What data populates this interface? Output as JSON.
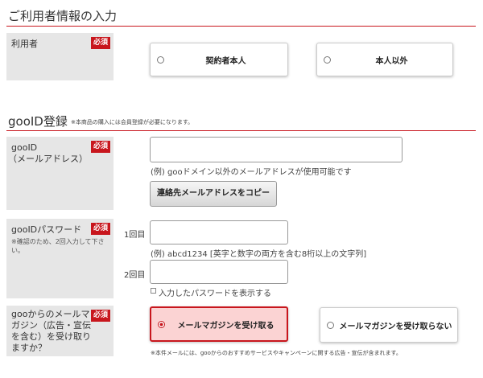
{
  "section1": {
    "title": "ご利用者情報の入力"
  },
  "user": {
    "label": "利用者",
    "required": "必須",
    "options": [
      "契約者本人",
      "本人以外"
    ]
  },
  "section2": {
    "title": "gooID登録",
    "note": "※本商品の購入には会員登録が必要になります。"
  },
  "gooid": {
    "label_line1": "gooID",
    "label_line2": "（メールアドレス）",
    "required": "必須",
    "hint": "(例) gooドメイン以外のメールアドレスが使用可能です",
    "copy_button": "連絡先メールアドレスをコピー"
  },
  "password": {
    "label": "gooIDパスワード",
    "note": "※確認のため、2回入力して下さい。",
    "required": "必須",
    "first_label": "1回目",
    "hint": "(例) abcd1234 [英字と数字の両方を含む8桁以上の文字列]",
    "second_label": "2回目",
    "show_password": "入力したパスワードを表示する"
  },
  "magazine": {
    "label_line1": "gooからのメールマ",
    "label_line2": "ガジン（広告・宣伝",
    "label_line3": "を含む）を受け取り",
    "label_line4": "ますか？",
    "required": "必須",
    "options": [
      "メールマガジンを受け取る",
      "メールマガジンを受け取らない"
    ],
    "selected_index": 0,
    "footnote": "※本件メールには、gooからのおすすめサービスやキャンペーンに関する広告・宣伝が含まれます。"
  },
  "colors": {
    "accent": "#c8161d",
    "label_bg": "#e6e6e6",
    "selected_bg": "#fbd3d3"
  }
}
